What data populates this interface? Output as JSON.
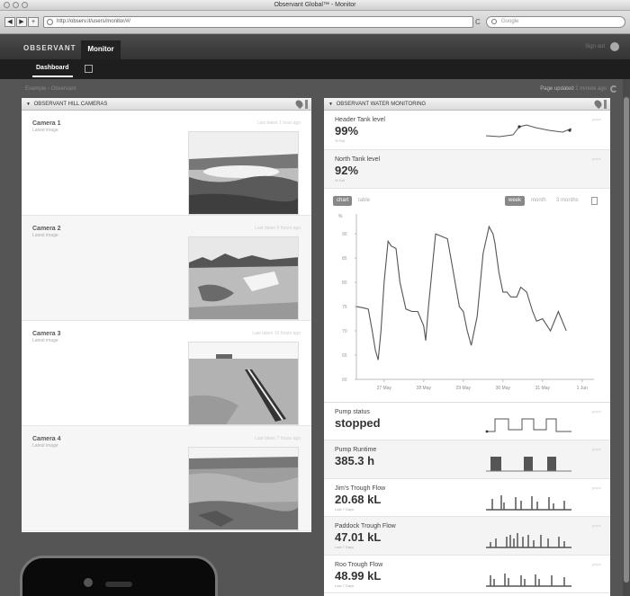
{
  "window": {
    "title": "Observant Global™ - Monitor"
  },
  "browser": {
    "url": "http://observ.it/users/monitor/#/",
    "search_placeholder": "Google",
    "nav": {
      "back": "◀",
      "forward": "▶",
      "add": "+"
    },
    "reload": "C"
  },
  "app": {
    "logo": "OBSERVANT",
    "top_tab": "Monitor",
    "sign_out": "Sign out",
    "sub_tab": "Dashboard",
    "breadcrumb": "Example › Observant",
    "updated_label": "Page updated",
    "updated_ago": "1 minute ago"
  },
  "cameras": {
    "title": "OBSERVANT HILL CAMERAS",
    "items": [
      {
        "name": "Camera 1",
        "sub": "Latest image",
        "time": "Last taken 1 hour ago"
      },
      {
        "name": "Camera 2",
        "sub": "Latest image",
        "time": "Last taken 5 hours ago"
      },
      {
        "name": "Camera 3",
        "sub": "Latest image",
        "time": "Last taken 10 hours ago"
      },
      {
        "name": "Camera 4",
        "sub": "Latest image",
        "time": "Last taken 7 hours ago"
      }
    ]
  },
  "water": {
    "title": "OBSERVANT WATER MONITORING",
    "header_tank": {
      "label": "Header Tank level",
      "value": "99%",
      "unit": "% Full",
      "tiny": "graph"
    },
    "north_tank": {
      "label": "North Tank level",
      "value": "92%",
      "unit": "% Full",
      "tiny": "graph"
    },
    "chart_toggle": {
      "chart": "chart",
      "table": "table"
    },
    "range": {
      "week": "week",
      "month": "month",
      "three_months": "3 months"
    },
    "pump_status": {
      "label": "Pump status",
      "value": "stopped",
      "tiny": "graph"
    },
    "pump_runtime": {
      "label": "Pump Runtime",
      "value": "385.3 h",
      "tiny": "graph"
    },
    "jims": {
      "label": "Jim's Trough Flow",
      "value": "20.68 kL",
      "sub": "Last 7 Days",
      "tiny": "graph"
    },
    "paddock": {
      "label": "Paddock Trough Flow",
      "value": "47.01 kL",
      "sub": "Last 7 Days",
      "tiny": "graph"
    },
    "roo": {
      "label": "Roo Trough Flow",
      "value": "48.99 kL",
      "sub": "Last 7 Days",
      "tiny": "graph"
    }
  },
  "chart_data": {
    "type": "line",
    "ylabel": "%",
    "yticks": [
      60,
      65,
      70,
      75,
      80,
      85,
      90
    ],
    "ylim": [
      60,
      93
    ],
    "xticks": [
      "27 May",
      "28 May",
      "29 May",
      "30 May",
      "31 May",
      "1 Jun"
    ],
    "xlim": [
      26.3,
      32.3
    ],
    "grid": false,
    "series": [
      {
        "x": [
          26.3,
          26.45,
          26.6,
          26.7,
          26.78,
          26.85,
          26.92,
          27.0,
          27.1,
          27.18,
          27.3,
          27.4,
          27.55,
          27.7,
          27.85,
          28.0,
          28.05,
          28.12,
          28.3,
          28.45,
          28.6,
          28.75,
          28.9,
          29.0,
          29.1,
          29.2,
          29.35,
          29.5,
          29.65,
          29.75,
          29.8,
          29.9,
          30.0,
          30.1,
          30.2,
          30.35,
          30.45,
          30.6,
          30.75,
          30.85,
          31.0,
          31.2,
          31.4,
          31.5,
          31.6
        ],
        "y": [
          75,
          74.8,
          74.5,
          70,
          66,
          64,
          70,
          80,
          88.5,
          87.5,
          87,
          80,
          74.5,
          74,
          74,
          71,
          68,
          75,
          90,
          89.5,
          89,
          82,
          75,
          74,
          70,
          67,
          73,
          86,
          91.5,
          90,
          88,
          82,
          78,
          78,
          77,
          77,
          79,
          78,
          74,
          72,
          72.5,
          70,
          74,
          72,
          70
        ]
      }
    ]
  }
}
